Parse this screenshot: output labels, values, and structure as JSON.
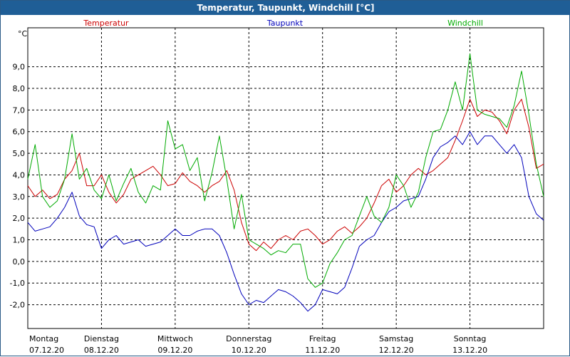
{
  "window": {
    "title": "Temperatur, Taupunkt, Windchill [°C]"
  },
  "chart_data": {
    "type": "line",
    "title": "Temperatur, Taupunkt, Windchill [°C]",
    "ylabel": "°C",
    "ylim": [
      -3.1,
      10.8
    ],
    "ytick_values": [
      -2,
      -1,
      0,
      1,
      2,
      3,
      4,
      5,
      6,
      7,
      8,
      9
    ],
    "ytick_labels": [
      "-2,0",
      "-1,0",
      "0,0",
      "1,0",
      "2,0",
      "3,0",
      "4,0",
      "5,0",
      "6,0",
      "7,0",
      "8,0",
      "9,0"
    ],
    "grid": true,
    "x_range": [
      0,
      7
    ],
    "days": [
      {
        "day": "Montag",
        "date": "07.12.20"
      },
      {
        "day": "Dienstag",
        "date": "08.12.20"
      },
      {
        "day": "Mittwoch",
        "date": "09.12.20"
      },
      {
        "day": "Donnerstag",
        "date": "10.12.20"
      },
      {
        "day": "Freitag",
        "date": "11.12.20"
      },
      {
        "day": "Samstag",
        "date": "12.12.20"
      },
      {
        "day": "Sonntag",
        "date": "13.12.20"
      }
    ],
    "series": [
      {
        "name": "Temperatur",
        "color": "#cc0000",
        "x": [
          0,
          0.1,
          0.2,
          0.3,
          0.4,
          0.5,
          0.6,
          0.7,
          0.8,
          0.9,
          1.0,
          1.1,
          1.2,
          1.3,
          1.4,
          1.5,
          1.6,
          1.7,
          1.8,
          1.9,
          2.0,
          2.1,
          2.2,
          2.3,
          2.4,
          2.5,
          2.6,
          2.7,
          2.8,
          2.9,
          3.0,
          3.1,
          3.2,
          3.3,
          3.4,
          3.5,
          3.6,
          3.7,
          3.8,
          3.9,
          4.0,
          4.1,
          4.2,
          4.3,
          4.4,
          4.5,
          4.6,
          4.7,
          4.8,
          4.9,
          5.0,
          5.1,
          5.2,
          5.3,
          5.4,
          5.5,
          5.6,
          5.7,
          5.8,
          5.9,
          6.0,
          6.1,
          6.2,
          6.3,
          6.4,
          6.5,
          6.6,
          6.7,
          6.8,
          6.9,
          7.0
        ],
        "y": [
          3.5,
          3.0,
          3.3,
          2.9,
          3.1,
          3.8,
          4.2,
          5.0,
          3.5,
          3.5,
          4.0,
          3.2,
          2.7,
          3.1,
          3.8,
          4.0,
          4.2,
          4.4,
          4.0,
          3.5,
          3.6,
          4.1,
          3.7,
          3.5,
          3.2,
          3.5,
          3.7,
          4.2,
          3.3,
          1.8,
          0.8,
          0.5,
          0.9,
          0.6,
          1.0,
          1.2,
          1.0,
          1.4,
          1.5,
          1.2,
          0.8,
          1.0,
          1.4,
          1.6,
          1.3,
          1.6,
          2.0,
          2.7,
          3.5,
          3.8,
          3.2,
          3.5,
          4.0,
          4.3,
          4.0,
          4.2,
          4.5,
          4.8,
          5.6,
          6.5,
          7.5,
          6.7,
          7.0,
          6.9,
          6.5,
          5.9,
          7.0,
          7.5,
          6.2,
          4.3,
          4.5
        ]
      },
      {
        "name": "Taupunkt",
        "color": "#0000bb",
        "x": [
          0,
          0.1,
          0.2,
          0.3,
          0.4,
          0.5,
          0.6,
          0.7,
          0.8,
          0.9,
          1.0,
          1.1,
          1.2,
          1.3,
          1.4,
          1.5,
          1.6,
          1.7,
          1.8,
          1.9,
          2.0,
          2.1,
          2.2,
          2.3,
          2.4,
          2.5,
          2.6,
          2.7,
          2.8,
          2.9,
          3.0,
          3.1,
          3.2,
          3.3,
          3.4,
          3.5,
          3.6,
          3.7,
          3.8,
          3.9,
          4.0,
          4.1,
          4.2,
          4.3,
          4.4,
          4.5,
          4.6,
          4.7,
          4.8,
          4.9,
          5.0,
          5.1,
          5.2,
          5.3,
          5.4,
          5.5,
          5.6,
          5.7,
          5.8,
          5.9,
          6.0,
          6.1,
          6.2,
          6.3,
          6.4,
          6.5,
          6.6,
          6.7,
          6.8,
          6.9,
          7.0
        ],
        "y": [
          1.8,
          1.4,
          1.5,
          1.6,
          2.0,
          2.5,
          3.2,
          2.1,
          1.7,
          1.6,
          0.6,
          1.0,
          1.2,
          0.8,
          0.9,
          1.0,
          0.7,
          0.8,
          0.9,
          1.2,
          1.5,
          1.2,
          1.2,
          1.4,
          1.5,
          1.5,
          1.2,
          0.4,
          -0.6,
          -1.5,
          -2.0,
          -1.8,
          -1.9,
          -1.6,
          -1.3,
          -1.4,
          -1.6,
          -1.9,
          -2.3,
          -2.0,
          -1.3,
          -1.4,
          -1.5,
          -1.2,
          -0.3,
          0.7,
          1.0,
          1.2,
          1.8,
          2.3,
          2.5,
          2.8,
          2.9,
          3.0,
          3.8,
          4.8,
          5.3,
          5.5,
          5.8,
          5.4,
          6.0,
          5.4,
          5.8,
          5.8,
          5.4,
          5.0,
          5.4,
          4.8,
          3.0,
          2.2,
          1.9
        ]
      },
      {
        "name": "Windchill",
        "color": "#00aa00",
        "x": [
          0,
          0.1,
          0.2,
          0.3,
          0.4,
          0.5,
          0.6,
          0.7,
          0.8,
          0.9,
          1.0,
          1.1,
          1.2,
          1.3,
          1.4,
          1.5,
          1.6,
          1.7,
          1.8,
          1.9,
          2.0,
          2.1,
          2.2,
          2.3,
          2.4,
          2.5,
          2.6,
          2.7,
          2.8,
          2.9,
          3.0,
          3.1,
          3.2,
          3.3,
          3.4,
          3.5,
          3.6,
          3.7,
          3.8,
          3.9,
          4.0,
          4.1,
          4.2,
          4.3,
          4.4,
          4.5,
          4.6,
          4.7,
          4.8,
          4.9,
          5.0,
          5.1,
          5.2,
          5.3,
          5.4,
          5.5,
          5.6,
          5.7,
          5.8,
          5.9,
          6.0,
          6.1,
          6.2,
          6.3,
          6.4,
          6.5,
          6.6,
          6.7,
          6.8,
          6.9,
          7.0
        ],
        "y": [
          3.8,
          5.4,
          3.0,
          2.5,
          2.8,
          3.8,
          5.9,
          3.8,
          4.3,
          3.3,
          2.9,
          4.0,
          2.8,
          3.6,
          4.3,
          3.2,
          2.7,
          3.5,
          3.3,
          6.5,
          5.2,
          5.4,
          4.2,
          4.8,
          2.8,
          4.1,
          5.8,
          3.8,
          1.5,
          3.1,
          1.0,
          0.8,
          0.6,
          0.3,
          0.5,
          0.4,
          0.8,
          0.8,
          -0.8,
          -1.2,
          -1.0,
          -0.1,
          0.4,
          1.0,
          1.2,
          2.1,
          3.0,
          2.1,
          1.8,
          2.5,
          4.0,
          3.5,
          2.5,
          3.2,
          4.8,
          6.0,
          6.1,
          7.0,
          8.3,
          7.0,
          9.6,
          7.0,
          6.8,
          6.7,
          6.6,
          6.2,
          7.2,
          8.8,
          6.8,
          4.5,
          3.0
        ]
      }
    ]
  }
}
